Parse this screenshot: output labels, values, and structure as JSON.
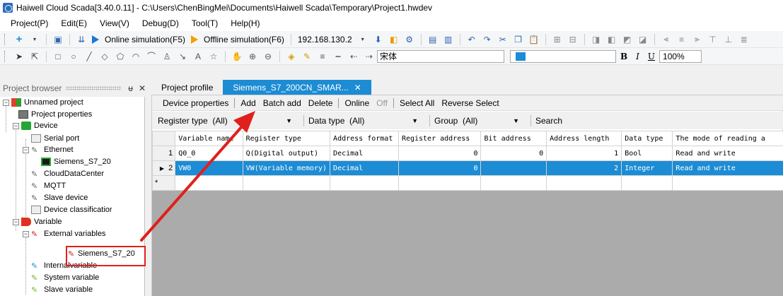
{
  "window": {
    "title": "Haiwell Cloud Scada[3.40.0.11] - C:\\Users\\ChenBingMei\\Documents\\Haiwell Scada\\Temporary\\Project1.hwdev"
  },
  "menu": [
    "Project(P)",
    "Edit(E)",
    "View(V)",
    "Debug(D)",
    "Tool(T)",
    "Help(H)"
  ],
  "toolbar1": {
    "online_sim": "Online simulation(F5)",
    "offline_sim": "Offline simulation(F6)",
    "ip": "192.168.130.2"
  },
  "toolbar2": {
    "font": "宋体",
    "bold": "B",
    "italic": "I",
    "underline": "U",
    "zoom": "100%"
  },
  "left_panel": {
    "title": "Project browser",
    "tree": {
      "root": "Unnamed project",
      "project_properties": "Project properties",
      "device": "Device",
      "serial_port": "Serial port",
      "ethernet": "Ethernet",
      "siemens_device": "Siemens_S7_20",
      "cloud_data_center": "CloudDataCenter",
      "mqtt": "MQTT",
      "slave_device": "Slave device",
      "device_classification": "Device classificatior",
      "variable": "Variable",
      "external_variables": "External variables",
      "siemens_var": "Siemens_S7_20",
      "internal_variable": "Internalvariable",
      "system_variable": "System variable",
      "slave_variable": "Slave variable"
    }
  },
  "tabs": [
    {
      "label": "Project profile",
      "active": false
    },
    {
      "label": "Siemens_S7_200CN_SMAR...",
      "active": true
    }
  ],
  "actions": {
    "device_properties": "Device properties",
    "add": "Add",
    "batch_add": "Batch add",
    "delete": "Delete",
    "online": "Online",
    "off": "Off",
    "select_all": "Select All",
    "reverse_select": "Reverse Select"
  },
  "filters": {
    "register_type_label": "Register type",
    "register_type_value": "(All)",
    "data_type_label": "Data type",
    "data_type_value": "(All)",
    "group_label": "Group",
    "group_value": "(All)",
    "search": "Search"
  },
  "grid": {
    "columns": [
      "Variable name",
      "Register type",
      "Address format",
      "Register address",
      "Bit address",
      "Address length",
      "Data type",
      "The mode of reading a"
    ],
    "rows": [
      {
        "n": "1",
        "name": "Q0_0",
        "reg_type": "Q(Digital output)",
        "format": "Decimal",
        "address": "0",
        "bit": "0",
        "length": "1",
        "dtype": "Bool",
        "mode": "Read and write"
      },
      {
        "n": "2",
        "name": "VW0",
        "reg_type": "VW(Variable memory)",
        "format": "Decimal",
        "address": "0",
        "bit": "",
        "length": "2",
        "dtype": "Integer",
        "mode": "Read and write"
      }
    ],
    "new_row_marker": "*"
  },
  "colors": {
    "accent": "#1c8cd4",
    "highlight": "#e0201c"
  }
}
